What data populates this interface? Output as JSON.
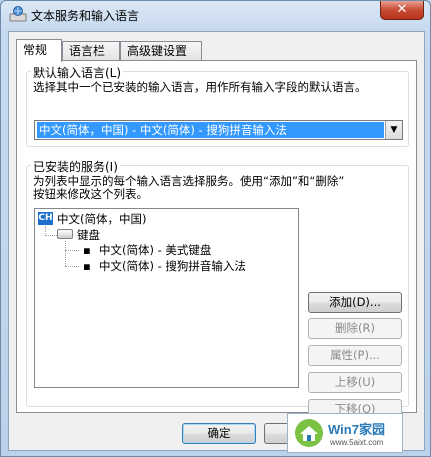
{
  "window": {
    "title": "文本服务和输入语言",
    "close_label": "✕"
  },
  "tabs": [
    {
      "label": "常规",
      "active": true
    },
    {
      "label": "语言栏",
      "active": false
    },
    {
      "label": "高级键设置",
      "active": false
    }
  ],
  "default_language": {
    "group_label": "默认输入语言(L)",
    "description": "选择其中一个已安装的输入语言，用作所有输入字段的默认语言。",
    "selected": "中文(简体，中国) - 中文(简体) - 搜狗拼音输入法"
  },
  "installed_services": {
    "group_label": "已安装的服务(I)",
    "description_line1": "为列表中显示的每个输入语言选择服务。使用“添加”和“删除”",
    "description_line2": "按钮来修改这个列表。",
    "tree": {
      "language_badge": "CH",
      "language": "中文(简体，中国)",
      "category": "键盘",
      "items": [
        "中文(简体) - 美式键盘",
        "中文(简体) - 搜狗拼音输入法"
      ]
    },
    "buttons": {
      "add": "添加(D)...",
      "remove": "删除(R)",
      "properties": "属性(P)...",
      "move_up": "上移(U)",
      "move_down": "下移(O)"
    }
  },
  "footer": {
    "ok": "确定"
  },
  "watermark": {
    "title": "Win7家园",
    "url": "www.5aixt.com"
  }
}
